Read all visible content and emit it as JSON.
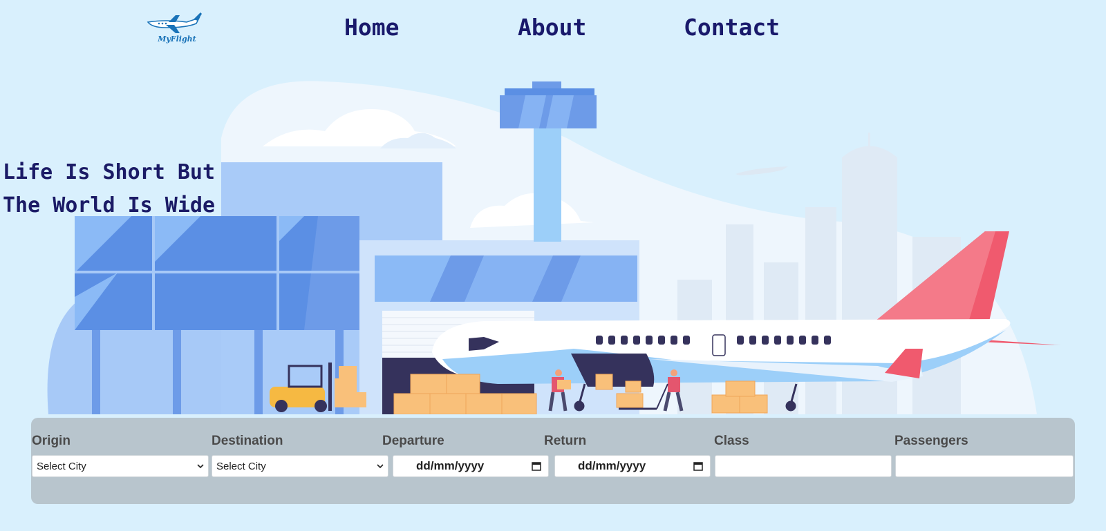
{
  "nav": {
    "logo_text": "MyFlight",
    "links": [
      "Home",
      "About",
      "Contact"
    ]
  },
  "hero": {
    "tagline_line1": "Life Is Short But",
    "tagline_line2": "The World Is Wide"
  },
  "search": {
    "origin_label": "Origin",
    "origin_value": "Select City",
    "destination_label": "Destination",
    "destination_value": "Select City",
    "departure_label": "Departure",
    "departure_value": "dd/mm/yyyy",
    "return_label": "Return",
    "return_value": "dd/mm/yyyy",
    "class_label": "Class",
    "class_value": "",
    "passengers_label": "Passengers",
    "passengers_value": ""
  },
  "colors": {
    "background": "#d9f0fd",
    "nav_text": "#19196b",
    "panel": "#b8c5cd",
    "tail": "#f05a6e"
  }
}
